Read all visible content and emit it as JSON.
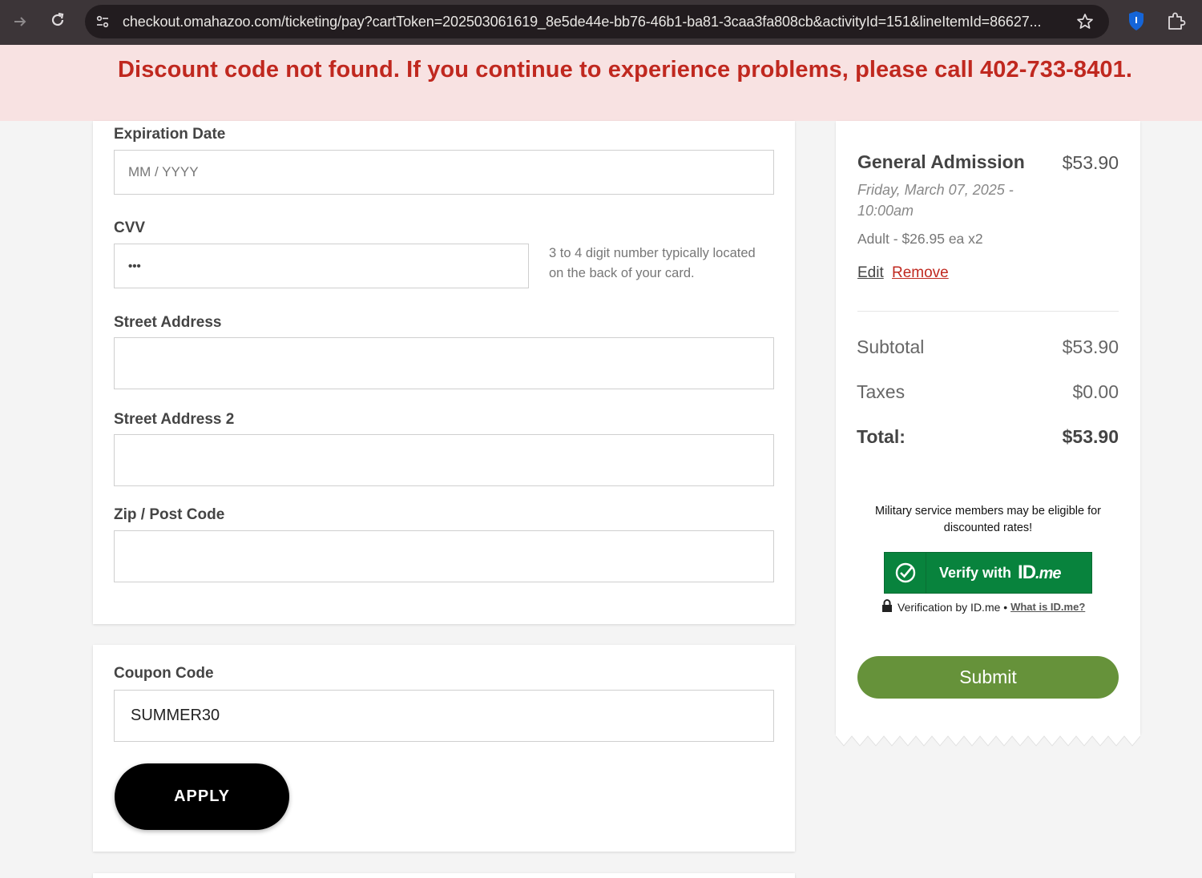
{
  "browser": {
    "url": "checkout.omahazoo.com/ticketing/pay?cartToken=202503061619_8e5de44e-bb76-46b1-ba81-3caa3fa808cb&activityId=151&lineItemId=86627..."
  },
  "banner": {
    "message": "Discount code not found. If you continue to experience problems, please call 402-733-8401."
  },
  "form": {
    "expiration": {
      "label": "Expiration Date",
      "placeholder": "MM / YYYY"
    },
    "cvv": {
      "label": "CVV",
      "value": "•••",
      "help": "3 to 4 digit number typically located on the back of your card."
    },
    "street": {
      "label": "Street Address",
      "value": ""
    },
    "street2": {
      "label": "Street Address 2",
      "value": ""
    },
    "zip": {
      "label": "Zip / Post Code",
      "value": ""
    }
  },
  "coupon": {
    "label": "Coupon Code",
    "value": "SUMMER30",
    "apply_label": "APPLY"
  },
  "summary": {
    "item": {
      "title": "General Admission",
      "price": "$53.90",
      "date": "Friday, March 07, 2025 - 10:00am",
      "qty": "Adult - $26.95 ea x2",
      "edit": "Edit",
      "remove": "Remove"
    },
    "subtotal_label": "Subtotal",
    "subtotal_value": "$53.90",
    "taxes_label": "Taxes",
    "taxes_value": "$0.00",
    "total_label": "Total:",
    "total_value": "$53.90",
    "military_text": "Military service members may be eligible for discounted rates!",
    "idme_button_text": "Verify with",
    "idme_logo_main": "ID",
    "idme_logo_suffix": ".me",
    "idme_note": "Verification by ID.me •",
    "idme_link": "What is ID.me?",
    "submit_label": "Submit"
  },
  "colors": {
    "error": "#c0281f",
    "banner_bg": "#f8e2e2",
    "idme_green": "#08833d",
    "submit_green": "#66923a"
  }
}
